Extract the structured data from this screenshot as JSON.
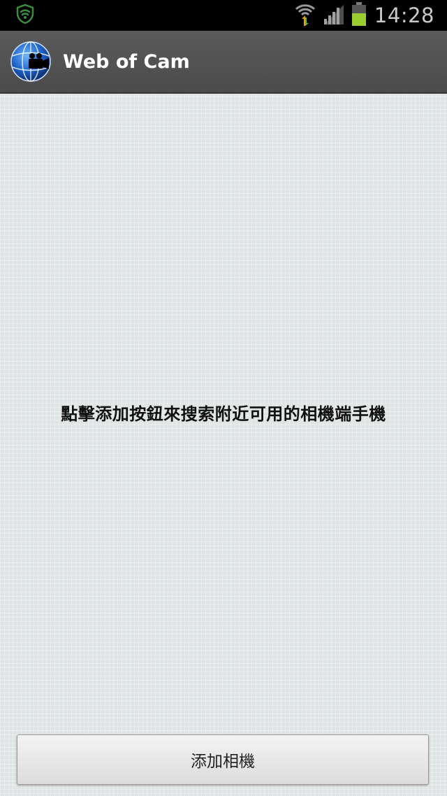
{
  "status_bar": {
    "time": "14:28",
    "icons": [
      "shield-icon",
      "wifi-icon",
      "signal-icon",
      "battery-icon"
    ]
  },
  "action_bar": {
    "title": "Web of Cam",
    "icon": "camera-globe-icon"
  },
  "main": {
    "message": "點擊添加按鈕來搜索附近可用的相機端手機"
  },
  "footer": {
    "add_button_label": "添加相機"
  },
  "colors": {
    "status_bar_bg": "#000000",
    "action_bar_bg": "#505050",
    "content_bg": "#dfe4e4",
    "shield": "#4caf50",
    "battery": "#9acd32"
  }
}
